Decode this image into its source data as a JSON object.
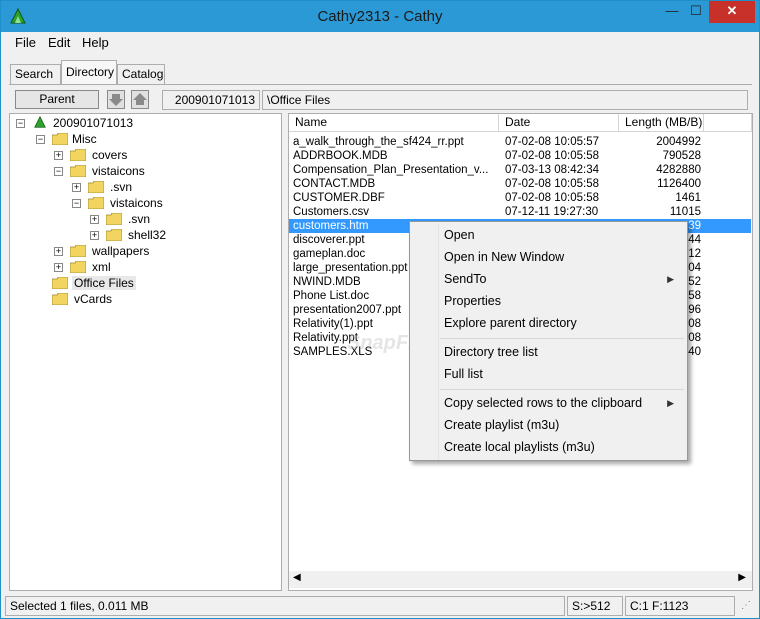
{
  "window": {
    "title": "Cathy2313 - Cathy",
    "min_label": "—",
    "max_label": "☐",
    "close_label": "✕"
  },
  "menu": [
    "File",
    "Edit",
    "Help"
  ],
  "tabs": [
    "Search",
    "Directory",
    "Catalog"
  ],
  "toolbar": {
    "parent_label": "Parent",
    "catalog_id": "200901071013",
    "path": "\\Office Files"
  },
  "tree": {
    "root": "200901071013",
    "nodes": [
      {
        "label": "Misc"
      },
      {
        "label": "covers"
      },
      {
        "label": "vistaicons"
      },
      {
        "label": ".svn"
      },
      {
        "label": "vistaicons"
      },
      {
        "label": ".svn"
      },
      {
        "label": "shell32"
      },
      {
        "label": "wallpapers"
      },
      {
        "label": "xml"
      },
      {
        "label": "Office Files"
      },
      {
        "label": "vCards"
      }
    ]
  },
  "list": {
    "columns": [
      "Name",
      "Date",
      "Length (MB/B)"
    ],
    "rows": [
      {
        "name": "a_walk_through_the_sf424_rr.ppt",
        "date": "07-02-08 10:05:57",
        "length": "2004992"
      },
      {
        "name": "ADDRBOOK.MDB",
        "date": "07-02-08 10:05:58",
        "length": "790528"
      },
      {
        "name": "Compensation_Plan_Presentation_v...",
        "date": "07-03-13 08:42:34",
        "length": "4282880"
      },
      {
        "name": "CONTACT.MDB",
        "date": "07-02-08 10:05:58",
        "length": "1126400"
      },
      {
        "name": "CUSTOMER.DBF",
        "date": "07-02-08 10:05:58",
        "length": "1461"
      },
      {
        "name": "Customers.csv",
        "date": "07-12-11 19:27:30",
        "length": "11015"
      },
      {
        "name": "customers.htm",
        "date": "",
        "length": "39"
      },
      {
        "name": "discoverer.ppt",
        "date": "",
        "length": "44"
      },
      {
        "name": "gameplan.doc",
        "date": "",
        "length": "12"
      },
      {
        "name": "large_presentation.ppt",
        "date": "",
        "length": "04"
      },
      {
        "name": "NWIND.MDB",
        "date": "",
        "length": "52"
      },
      {
        "name": "Phone List.doc",
        "date": "",
        "length": "58"
      },
      {
        "name": "presentation2007.ppt",
        "date": "",
        "length": "96"
      },
      {
        "name": "Relativity(1).ppt",
        "date": "",
        "length": "08"
      },
      {
        "name": "Relativity.ppt",
        "date": "",
        "length": "08"
      },
      {
        "name": "SAMPLES.XLS",
        "date": "",
        "length": "40"
      }
    ]
  },
  "context_menu": {
    "open": "Open",
    "open_new_window": "Open in New Window",
    "send_to": "SendTo",
    "properties": "Properties",
    "explore_parent": "Explore parent directory",
    "directory_tree_list": "Directory tree list",
    "full_list": "Full list",
    "copy_rows": "Copy selected rows to the clipboard",
    "create_playlist": "Create playlist (m3u)",
    "create_local_playlists": "Create local playlists (m3u)"
  },
  "status": {
    "selected": "Selected 1 files, 0.011 MB",
    "sort": "S:>512",
    "position": "C:1 F:1123"
  },
  "watermark": "SnapFiles",
  "colors": {
    "titlebar": "#2b99d5",
    "selection": "#3399ff",
    "close": "#c7312a",
    "folder": "#f2d460"
  }
}
